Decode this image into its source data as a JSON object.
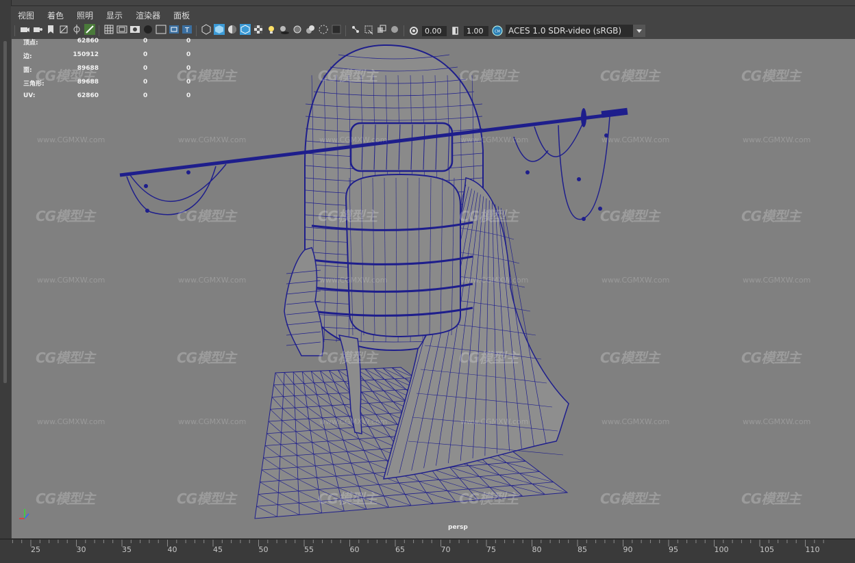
{
  "menu": [
    "视图",
    "着色",
    "照明",
    "显示",
    "渲染器",
    "面板"
  ],
  "toolbar": {
    "exposure_value": "0.00",
    "gamma_value": "1.00",
    "color_management": "ACES 1.0 SDR-video (sRGB)",
    "icons": [
      "select-camera-icon",
      "camera-attributes-icon",
      "bookmark-icon",
      "image-plane-icon",
      "2d-pan-zoom-icon",
      "grease-pencil-icon",
      "grid-icon",
      "film-gate-icon",
      "resolution-gate-icon",
      "gate-mask-icon",
      "field-chart-icon",
      "safe-action-icon",
      "safe-title-icon",
      "wireframe-icon",
      "smooth-shade-icon",
      "default-material-icon",
      "wireframe-on-shaded-icon",
      "textured-icon",
      "lighting-icon",
      "shadows-icon",
      "screen-space-ao-icon",
      "motion-blur-icon",
      "anti-aliasing-icon",
      "depth-of-field-icon",
      "isolate-select-icon",
      "xray-icon",
      "xray-joints-icon",
      "xray-components-icon",
      "exposure-icon",
      "gamma-icon",
      "color-management-icon"
    ]
  },
  "hud": {
    "rows": [
      {
        "label": "顶点:",
        "value": "62860",
        "v2": "0",
        "v3": "0"
      },
      {
        "label": "边:",
        "value": "150912",
        "v2": "0",
        "v3": "0"
      },
      {
        "label": "面:",
        "value": "89688",
        "v2": "0",
        "v3": "0"
      },
      {
        "label": "三角形:",
        "value": "89688",
        "v2": "0",
        "v3": "0"
      },
      {
        "label": "UV:",
        "value": "62860",
        "v2": "0",
        "v3": "0"
      }
    ]
  },
  "viewport_label": "persp",
  "timeline_ticks": [
    "25",
    "30",
    "35",
    "40",
    "45",
    "50",
    "55",
    "60",
    "65",
    "70",
    "75",
    "80",
    "85",
    "90",
    "95",
    "100",
    "105",
    "110"
  ],
  "watermark": {
    "logo": "CG模型主",
    "url": "www.CGMXW.com"
  },
  "colors": {
    "wire": "#1e1e8c",
    "viewport_bg": "#808080",
    "ui_bg": "#444444"
  }
}
